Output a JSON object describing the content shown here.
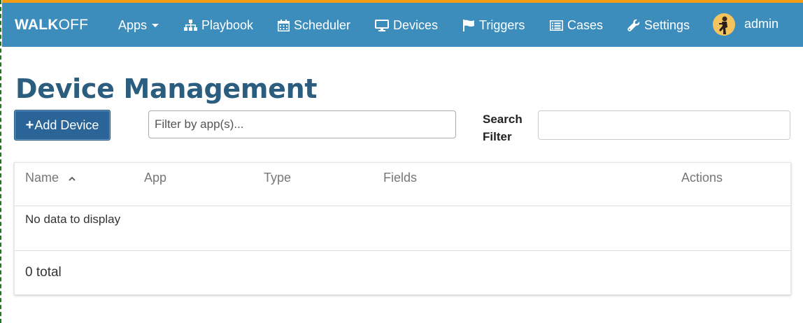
{
  "navbar": {
    "brand_bold": "WALK",
    "brand_light": "OFF",
    "items": [
      {
        "label": "Apps",
        "icon": "caret-down-icon"
      },
      {
        "label": "Playbook",
        "icon": "sitemap-icon"
      },
      {
        "label": "Scheduler",
        "icon": "calendar-icon"
      },
      {
        "label": "Devices",
        "icon": "monitor-icon"
      },
      {
        "label": "Triggers",
        "icon": "flag-icon"
      },
      {
        "label": "Cases",
        "icon": "list-icon"
      },
      {
        "label": "Settings",
        "icon": "wrench-icon"
      }
    ],
    "user": "admin",
    "colors": {
      "bar": "#3c8dbc",
      "accent_top": "#f39c12"
    }
  },
  "page": {
    "title": "Device Management",
    "add_button": "Add Device",
    "app_filter_placeholder": "Filter by app(s)...",
    "search_label": "Search Filter",
    "search_value": ""
  },
  "table": {
    "columns": [
      "Name",
      "App",
      "Type",
      "Fields",
      "Actions"
    ],
    "empty_message": "No data to display",
    "total": "0 total"
  }
}
